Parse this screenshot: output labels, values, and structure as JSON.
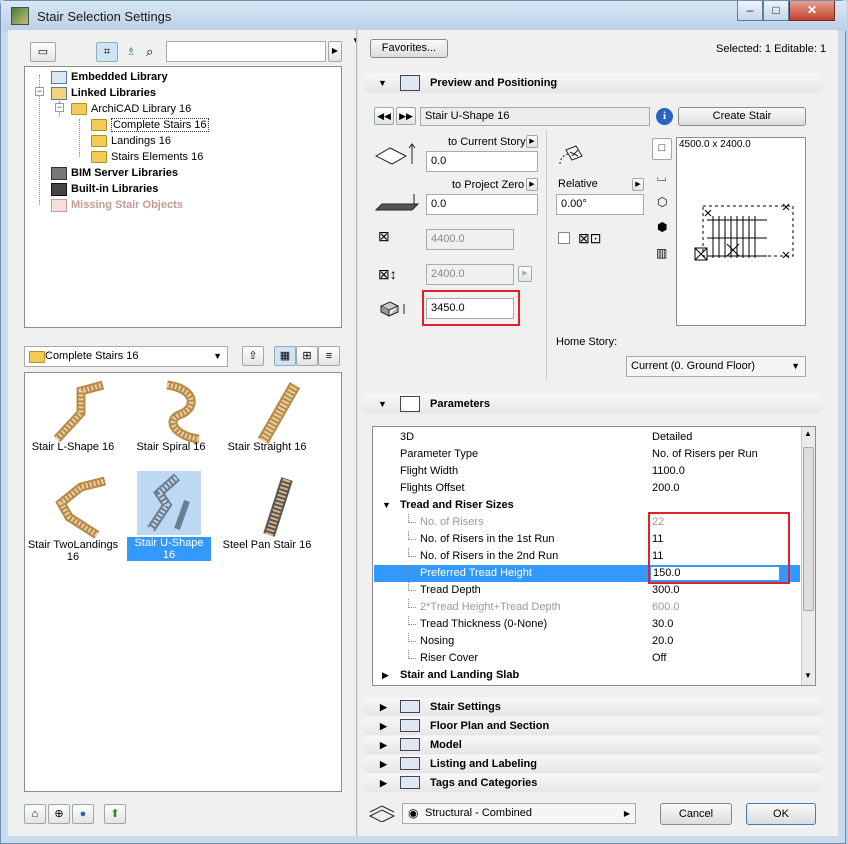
{
  "window": {
    "title": "Stair Selection Settings",
    "minimize": "–",
    "maximize": "□",
    "close": "✕"
  },
  "library_tree": [
    {
      "label": "Embedded Library",
      "bold": true
    },
    {
      "label": "Linked Libraries",
      "bold": true
    },
    {
      "label": "ArchiCAD Library 16"
    },
    {
      "label": "Complete Stairs 16",
      "selected": true
    },
    {
      "label": "Landings 16"
    },
    {
      "label": "Stairs Elements 16"
    },
    {
      "label": "BIM Server Libraries",
      "bold": true
    },
    {
      "label": "Built-in Libraries",
      "bold": true
    },
    {
      "label": "Missing Stair Objects",
      "muted": true
    }
  ],
  "folder_select": {
    "value": "Complete Stairs 16"
  },
  "objects": [
    {
      "label": "Stair L-Shape 16"
    },
    {
      "label": "Stair Spiral 16"
    },
    {
      "label": "Stair Straight 16"
    },
    {
      "label": "Stair TwoLandings 16"
    },
    {
      "label": "Stair U-Shape 16",
      "selected": true
    },
    {
      "label": "Steel Pan Stair 16"
    }
  ],
  "toolbar": {
    "favorites": "Favorites...",
    "selected_info": "Selected: 1 Editable: 1"
  },
  "preview": {
    "section_title": "Preview and Positioning",
    "object_name": "Stair U-Shape 16",
    "create_stair": "Create Stair",
    "to_current_story": "to Current Story",
    "to_current_story_value": "0.0",
    "to_project_zero": "to Project Zero",
    "to_project_zero_value": "0.0",
    "width_value": "4400.0",
    "length_value": "2400.0",
    "height_value": "3450.0",
    "relative": "Relative",
    "angle_value": "0.00°",
    "size_label": "4500.0 x 2400.0",
    "home_story_label": "Home Story:",
    "home_story_value": "Current (0. Ground Floor)"
  },
  "parameters": {
    "section_title": "Parameters",
    "rows": [
      {
        "name": "3D",
        "value": "Detailed",
        "indent": 0
      },
      {
        "name": "Parameter Type",
        "value": "No. of Risers per Run",
        "indent": 0
      },
      {
        "name": "Flight Width",
        "value": "1100.0",
        "indent": 0
      },
      {
        "name": "Flights Offset",
        "value": "200.0",
        "indent": 0
      },
      {
        "name": "Tread and Riser Sizes",
        "value": "",
        "indent": 0,
        "group": true,
        "open": true
      },
      {
        "name": "No. of Risers",
        "value": "22",
        "indent": 1,
        "gray": true
      },
      {
        "name": "No. of Risers in the 1st Run",
        "value": "11",
        "indent": 1
      },
      {
        "name": "No. of Risers in the 2nd Run",
        "value": "11",
        "indent": 1
      },
      {
        "name": "Preferred Tread Height",
        "value": "150.0",
        "indent": 1,
        "selected": true
      },
      {
        "name": "Tread Depth",
        "value": "300.0",
        "indent": 1
      },
      {
        "name": "2*Tread Height+Tread Depth",
        "value": "600.0",
        "indent": 1,
        "gray": true
      },
      {
        "name": "Tread Thickness (0-None)",
        "value": "30.0",
        "indent": 1
      },
      {
        "name": "Nosing",
        "value": "20.0",
        "indent": 1
      },
      {
        "name": "Riser Cover",
        "value": "Off",
        "indent": 1
      },
      {
        "name": "Stair and Landing Slab",
        "value": "",
        "indent": 0,
        "group": true,
        "open": false
      }
    ]
  },
  "sections": [
    {
      "label": "Stair Settings"
    },
    {
      "label": "Floor Plan and Section"
    },
    {
      "label": "Model"
    },
    {
      "label": "Listing and Labeling"
    },
    {
      "label": "Tags and Categories"
    }
  ],
  "footer": {
    "layer": "Structural - Combined",
    "cancel": "Cancel",
    "ok": "OK"
  }
}
